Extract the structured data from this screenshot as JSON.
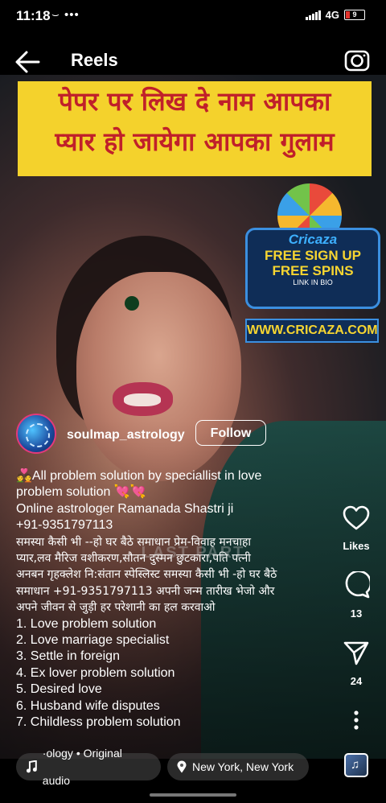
{
  "status": {
    "time": "11:18",
    "left_icons": "⌣ •••",
    "network": "4G",
    "battery": "9"
  },
  "header": {
    "title": "Reels",
    "back_icon": "arrow-left-icon",
    "camera_icon": "camera-icon"
  },
  "video": {
    "banner_line1": "पेपर पर लिख दे नाम आपका",
    "banner_line2": "प्यार हो जायेगा आपका गुलाम",
    "ad_brand": "Cricaza",
    "ad_line1": "FREE SIGN UP",
    "ad_line2": "FREE SPINS",
    "ad_line3": "LINK IN BIO",
    "ad_url": "WWW.CRICAZA.COM",
    "watermark": "LAST PART"
  },
  "author": {
    "username": "soulmap_astrology",
    "follow_label": "Follow"
  },
  "caption": {
    "lines": [
      "💑All problem solution by speciallist in love",
      "problem solution 💘💘",
      "Online astrologer  Ramanada Shastri ji",
      "+91-9351797113",
      "समस्या कैसी भी --हो घर बैठे समाधान प्रेम-विवाह मनचाहा",
      "प्यार,लव मैरिज वशीकरण,सौतन दुस्मन छुटकारा,पति पत्नी",
      "अनबन गृहक्लेश नि:संतान स्पेस्लिस्ट समस्या कैसी भी -हो घर बैठे",
      "समाधान +91-9351797113 अपनी जन्म तारीख भेजो और",
      "अपने जीवन से जुड़ी हर परेशानी का हल करवाओ",
      "1. Love problem solution",
      "2. Love marriage specialist",
      "3. Settle in foreign",
      "4. Ex lover problem solution",
      "5. Desired love",
      "6. Husband wife disputes",
      "7. Childless problem solution"
    ]
  },
  "rail": {
    "likes_label": "Likes",
    "comments_count": "13",
    "shares_count": "24",
    "like_icon": "heart-icon",
    "comment_icon": "comment-icon",
    "share_icon": "send-icon",
    "more_icon": "more-vertical-icon"
  },
  "bottom": {
    "audio_label": "·ology • Original audio",
    "location_label": "New York, New York"
  }
}
